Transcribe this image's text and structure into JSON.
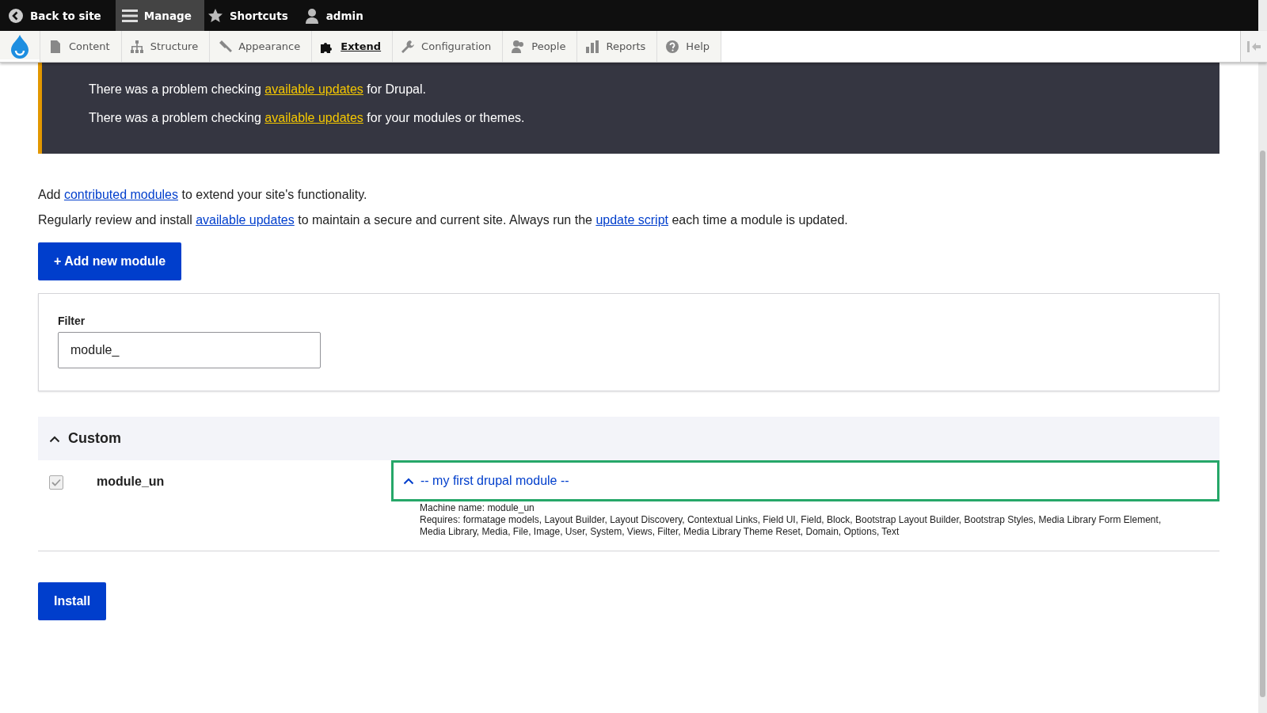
{
  "toolbar": {
    "items": [
      {
        "label": "Back to site",
        "selected": false
      },
      {
        "label": "Manage",
        "selected": true
      },
      {
        "label": "Shortcuts",
        "selected": false
      },
      {
        "label": "admin",
        "selected": false
      }
    ]
  },
  "admin_menu": {
    "items": [
      {
        "label": "Content",
        "selected": false
      },
      {
        "label": "Structure",
        "selected": false
      },
      {
        "label": "Appearance",
        "selected": false
      },
      {
        "label": "Extend",
        "selected": true
      },
      {
        "label": "Configuration",
        "selected": false
      },
      {
        "label": "People",
        "selected": false
      },
      {
        "label": "Reports",
        "selected": false
      },
      {
        "label": "Help",
        "selected": false
      }
    ]
  },
  "warning": {
    "lines": [
      {
        "before": "There was a problem checking ",
        "link": "available updates",
        "after": " for Drupal."
      },
      {
        "before": "There was a problem checking ",
        "link": "available updates",
        "after": " for your modules or themes."
      }
    ]
  },
  "intro": [
    {
      "parts": [
        {
          "text": "Add "
        },
        {
          "text": "contributed modules",
          "link": true
        },
        {
          "text": " to extend your site's functionality."
        }
      ]
    },
    {
      "parts": [
        {
          "text": "Regularly review and install "
        },
        {
          "text": "available updates",
          "link": true
        },
        {
          "text": " to maintain a secure and current site. Always run the "
        },
        {
          "text": "update script",
          "link": true
        },
        {
          "text": " each time a module is updated."
        }
      ]
    }
  ],
  "add_button": "+ Add new module",
  "filter": {
    "label": "Filter",
    "value": "module_"
  },
  "section": {
    "title": "Custom",
    "expanded": true,
    "modules": [
      {
        "name": "module_un",
        "checked": true,
        "disabled": true,
        "description": "-- my first drupal module --",
        "expanded": true,
        "machine_name": "Machine name: module_un",
        "requires": "Requires: formatage models, Layout Builder, Layout Discovery, Contextual Links, Field UI, Field, Block, Bootstrap Layout Builder, Bootstrap Styles, Media Library Form Element, Media Library, Media, File, Image, User, System, Views, Filter, Media Library Theme Reset, Domain, Options, Text"
      }
    ]
  },
  "install_button": "Install"
}
